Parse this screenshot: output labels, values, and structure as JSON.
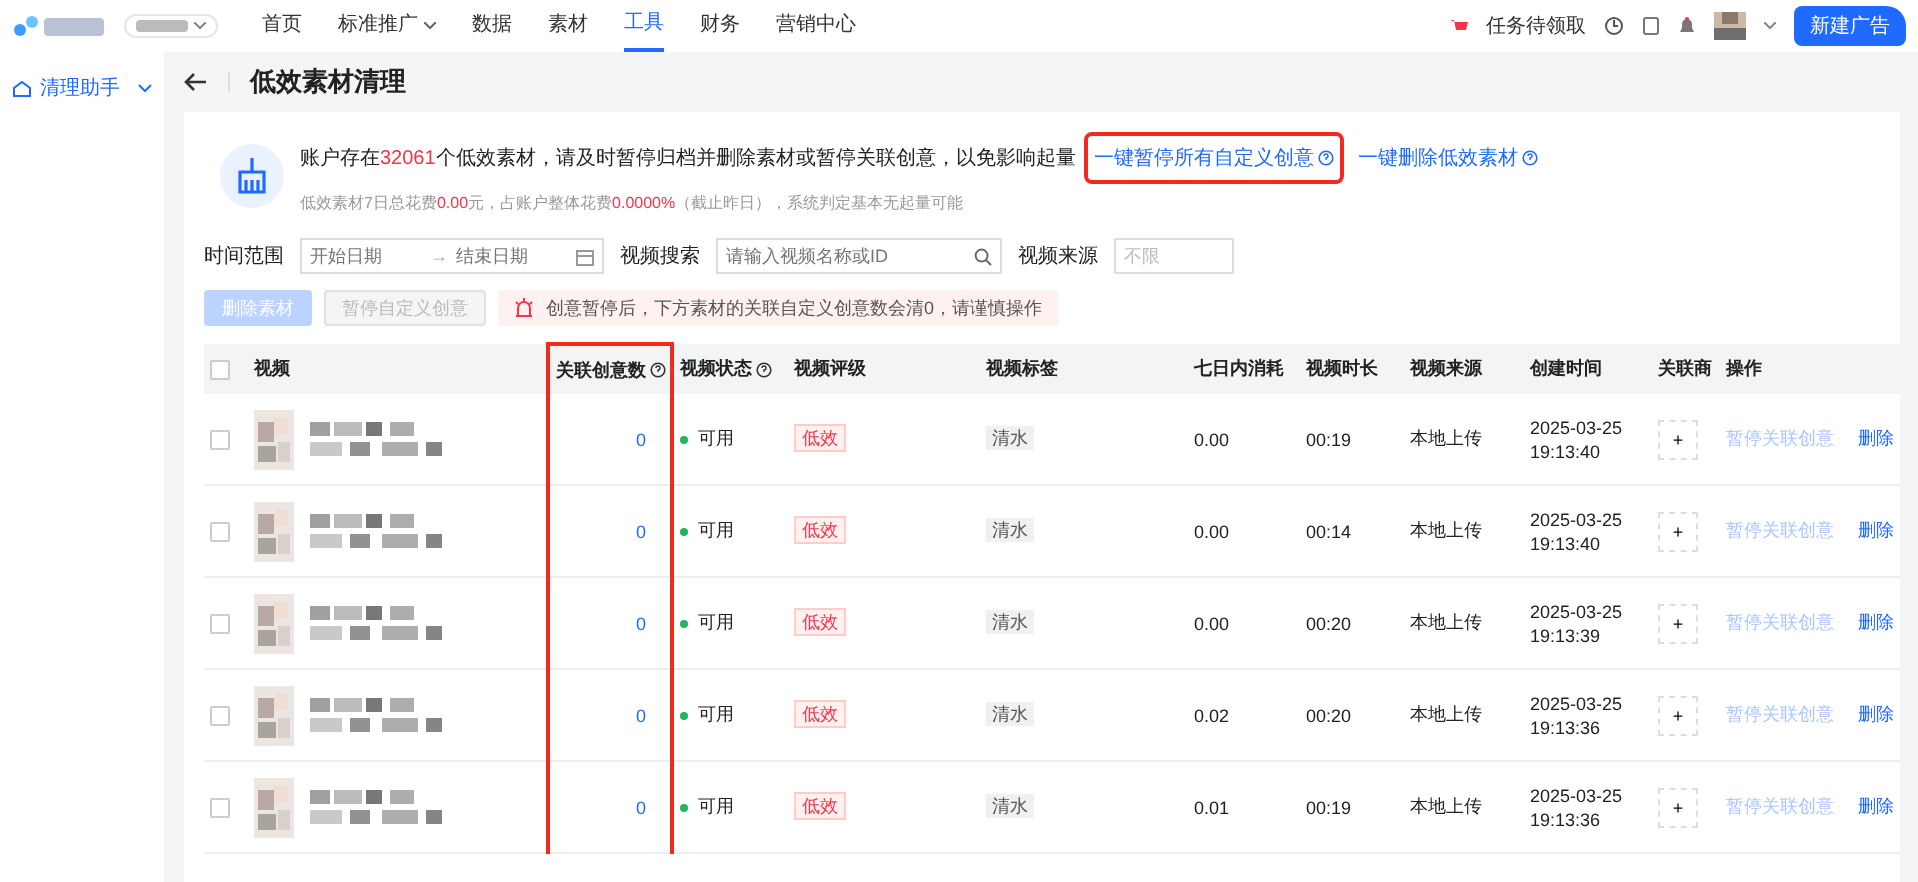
{
  "nav": {
    "items": [
      {
        "label": "首页",
        "selected": false,
        "dropdown": false
      },
      {
        "label": "标准推广",
        "selected": false,
        "dropdown": true
      },
      {
        "label": "数据",
        "selected": false,
        "dropdown": false
      },
      {
        "label": "素材",
        "selected": false,
        "dropdown": false
      },
      {
        "label": "工具",
        "selected": true,
        "dropdown": false
      },
      {
        "label": "财务",
        "selected": false,
        "dropdown": false
      },
      {
        "label": "营销中心",
        "selected": false,
        "dropdown": false
      }
    ],
    "task": "任务待领取",
    "cta": "新建广告"
  },
  "sidebar": {
    "items": [
      {
        "label": "清理助手",
        "expanded": true
      }
    ]
  },
  "page": {
    "title": "低效素材清理"
  },
  "notice": {
    "line1": [
      {
        "text": "账户存在",
        "highlight": false
      },
      {
        "text": "32061",
        "highlight": true
      },
      {
        "text": "个低效素材，请及时暂停归档并删除素材或暂停关联创意，以免影响起量",
        "highlight": false
      }
    ],
    "links": [
      {
        "label": "一键暂停所有自定义创意",
        "highlighted": true
      },
      {
        "label": "一键删除低效素材",
        "highlighted": false
      }
    ],
    "line2": [
      {
        "text": "低效素材7日总花费",
        "highlight": false
      },
      {
        "text": "0.00",
        "highlight": true
      },
      {
        "text": "元，占账户整体花费",
        "highlight": false
      },
      {
        "text": "0.0000%",
        "highlight": true
      },
      {
        "text": "（截止昨日），系统判定基本无起量可能",
        "highlight": false
      }
    ]
  },
  "filters": {
    "time_label": "时间范围",
    "start_placeholder": "开始日期",
    "range_separator": "→",
    "end_placeholder": "结束日期",
    "search_label": "视频搜索",
    "search_placeholder": "请输入视频名称或ID",
    "source_label": "视频来源",
    "source_value": "不限"
  },
  "actions": [
    {
      "label": "删除素材",
      "kind": "primary",
      "disabled": true
    },
    {
      "label": "暂停自定义创意",
      "kind": "default",
      "disabled": true
    }
  ],
  "alert": "创意暂停后，下方素材的关联自定义创意数会清0，请谨慎操作",
  "table": {
    "all_checked": false,
    "columns": [
      {
        "label": "视频",
        "kind": "video",
        "help": false,
        "highlighted": false
      },
      {
        "label": "关联创意数",
        "kind": "count",
        "help": true,
        "highlighted": true
      },
      {
        "label": "视频状态",
        "kind": "status",
        "help": true,
        "highlighted": false
      },
      {
        "label": "视频评级",
        "kind": "grade",
        "help": false,
        "highlighted": false
      },
      {
        "label": "视频标签",
        "kind": "tag",
        "help": false,
        "highlighted": false
      },
      {
        "label": "七日内消耗",
        "kind": "cost",
        "help": false,
        "highlighted": false
      },
      {
        "label": "视频时长",
        "kind": "duration",
        "help": false,
        "highlighted": false
      },
      {
        "label": "视频来源",
        "kind": "source",
        "help": false,
        "highlighted": false
      },
      {
        "label": "创建时间",
        "kind": "created",
        "help": false,
        "highlighted": false
      },
      {
        "label": "关联商",
        "kind": "add",
        "help": false,
        "highlighted": false
      },
      {
        "label": "操作",
        "kind": "actions",
        "help": false,
        "highlighted": false
      }
    ],
    "rows": [
      {
        "checked": false,
        "count": "0",
        "status": "可用",
        "grade": "低效",
        "tag": "清水",
        "cost": "0.00",
        "duration": "00:19",
        "source": "本地上传",
        "created_date": "2025-03-25",
        "created_time": "19:13:40",
        "add": "+",
        "actions": [
          {
            "label": "暂停关联创意",
            "disabled": true
          },
          {
            "label": "删除",
            "disabled": false
          }
        ]
      },
      {
        "checked": false,
        "count": "0",
        "status": "可用",
        "grade": "低效",
        "tag": "清水",
        "cost": "0.00",
        "duration": "00:14",
        "source": "本地上传",
        "created_date": "2025-03-25",
        "created_time": "19:13:40",
        "add": "+",
        "actions": [
          {
            "label": "暂停关联创意",
            "disabled": true
          },
          {
            "label": "删除",
            "disabled": false
          }
        ]
      },
      {
        "checked": false,
        "count": "0",
        "status": "可用",
        "grade": "低效",
        "tag": "清水",
        "cost": "0.00",
        "duration": "00:20",
        "source": "本地上传",
        "created_date": "2025-03-25",
        "created_time": "19:13:39",
        "add": "+",
        "actions": [
          {
            "label": "暂停关联创意",
            "disabled": true
          },
          {
            "label": "删除",
            "disabled": false
          }
        ]
      },
      {
        "checked": false,
        "count": "0",
        "status": "可用",
        "grade": "低效",
        "tag": "清水",
        "cost": "0.02",
        "duration": "00:20",
        "source": "本地上传",
        "created_date": "2025-03-25",
        "created_time": "19:13:36",
        "add": "+",
        "actions": [
          {
            "label": "暂停关联创意",
            "disabled": true
          },
          {
            "label": "删除",
            "disabled": false
          }
        ]
      },
      {
        "checked": false,
        "count": "0",
        "status": "可用",
        "grade": "低效",
        "tag": "清水",
        "cost": "0.01",
        "duration": "00:19",
        "source": "本地上传",
        "created_date": "2025-03-25",
        "created_time": "19:13:36",
        "add": "+",
        "actions": [
          {
            "label": "暂停关联创意",
            "disabled": true
          },
          {
            "label": "删除",
            "disabled": false
          }
        ]
      }
    ]
  }
}
